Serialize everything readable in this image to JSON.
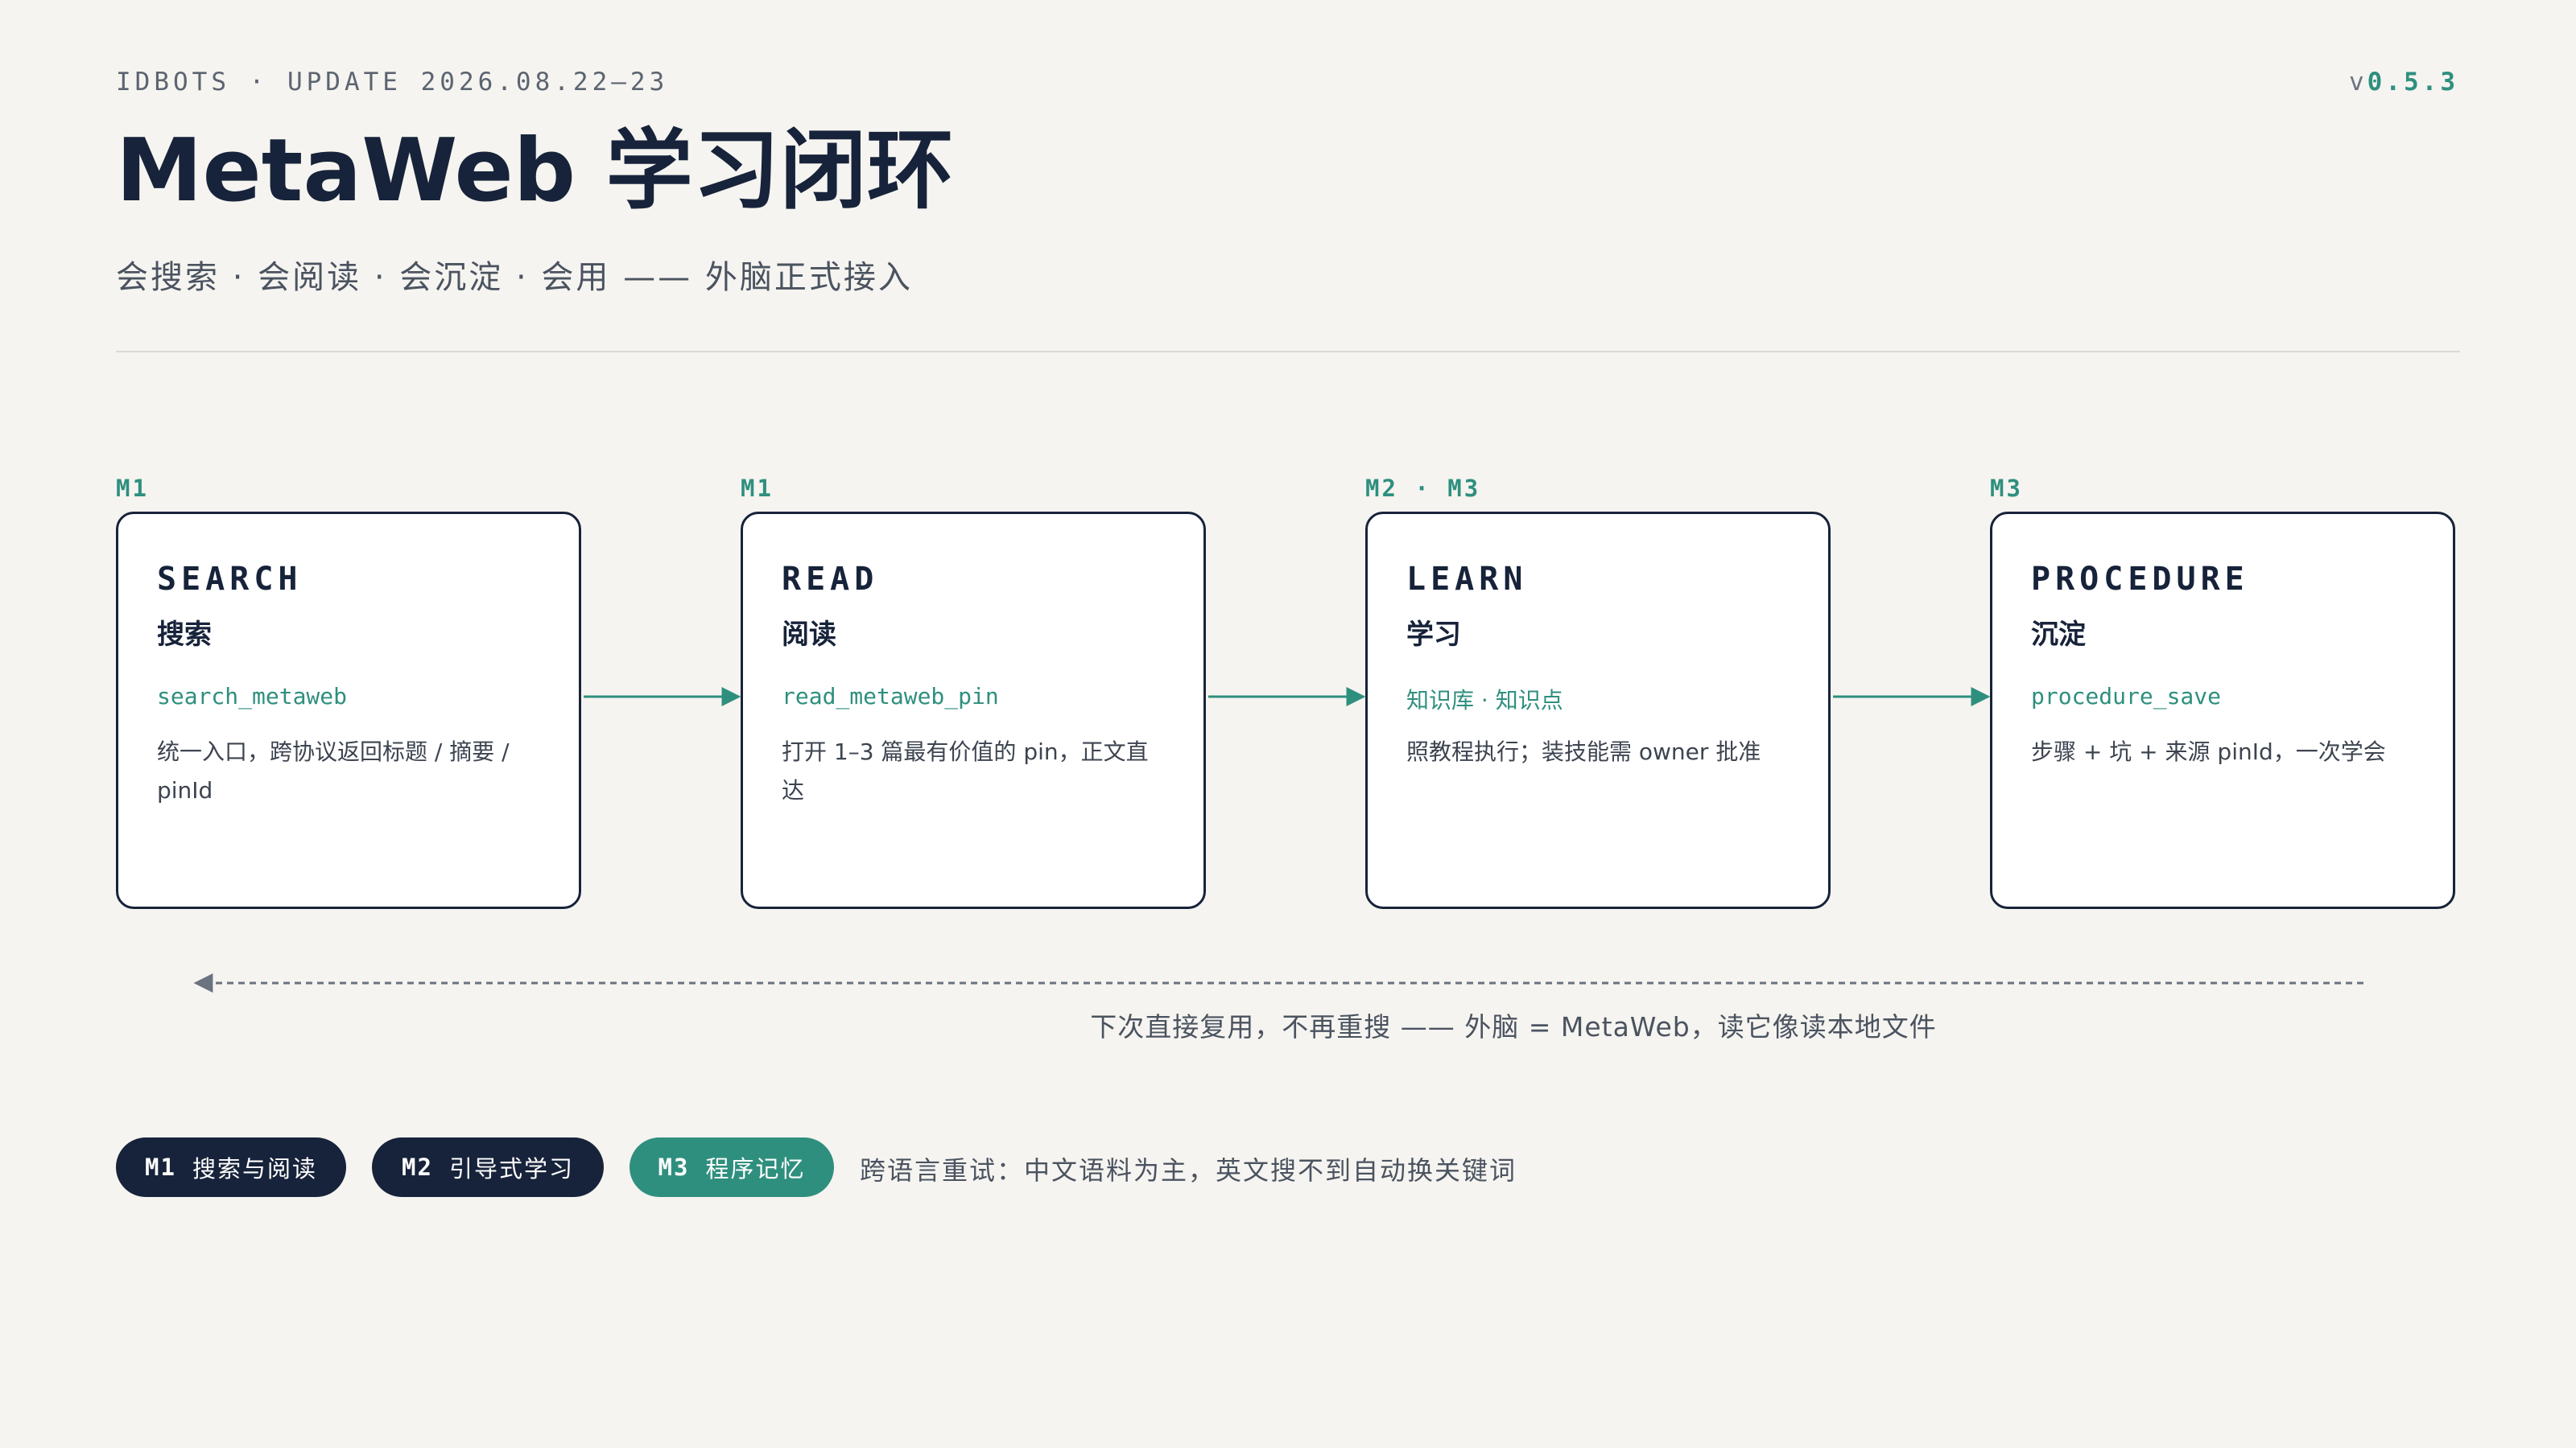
{
  "header": {
    "eyebrow": "IDBOTS · UPDATE 2026.08.22–23",
    "version_prefix": "v",
    "version_number": "0.5.3",
    "title": "MetaWeb 学习闭环",
    "subtitle": "会搜索 · 会阅读 · 会沉淀 · 会用 —— 外脑正式接入"
  },
  "stages": [
    {
      "tag": "M1",
      "en": "SEARCH",
      "zh": "搜索",
      "tool": "search_metaweb",
      "desc": "统一入口，跨协议返回标题 / 摘要 / pinId"
    },
    {
      "tag": "M1",
      "en": "READ",
      "zh": "阅读",
      "tool": "read_metaweb_pin",
      "desc": "打开 1–3 篇最有价值的 pin，正文直达"
    },
    {
      "tag": "M2 · M3",
      "en": "LEARN",
      "zh": "学习",
      "tool": "知识库 · 知识点",
      "desc": "照教程执行；装技能需 owner 批准"
    },
    {
      "tag": "M3",
      "en": "PROCEDURE",
      "zh": "沉淀",
      "tool": "procedure_save",
      "desc": "步骤 + 坑 + 来源 pinId，一次学会"
    }
  ],
  "loop": {
    "caption": "下次直接复用，不再重搜 —— 外脑 = MetaWeb，读它像读本地文件"
  },
  "legend": {
    "pills": [
      {
        "code": "M1",
        "label": "搜索与阅读",
        "color": "#17233a"
      },
      {
        "code": "M2",
        "label": "引导式学习",
        "color": "#17233a"
      },
      {
        "code": "M3",
        "label": "程序记忆",
        "color": "#2f8f7e"
      }
    ],
    "note": "跨语言重试：中文语料为主，英文搜不到自动换关键词"
  },
  "colors": {
    "background": "#f5f4f0",
    "ink": "#17233a",
    "accent": "#2f8f7e",
    "muted": "#4b5360"
  }
}
